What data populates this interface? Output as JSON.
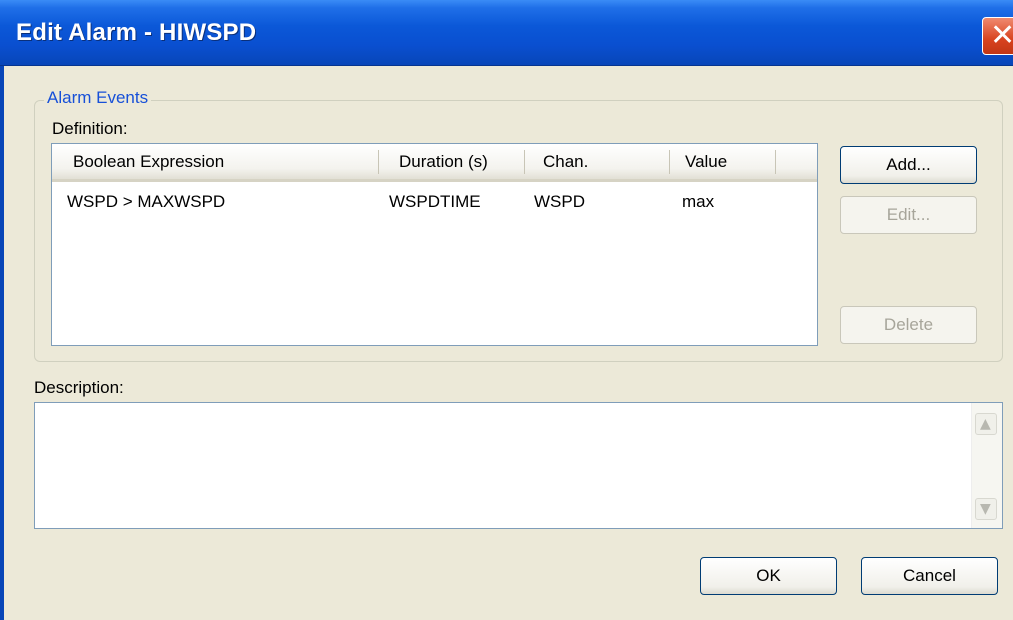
{
  "window": {
    "title": "Edit Alarm - HIWSPD"
  },
  "group": {
    "legend": "Alarm Events"
  },
  "definition": {
    "label": "Definition:",
    "columns": [
      "Boolean Expression",
      "Duration (s)",
      "Chan.",
      "Value"
    ],
    "rows": [
      [
        "WSPD > MAXWSPD",
        "WSPDTIME",
        "WSPD",
        "max"
      ]
    ]
  },
  "buttons": {
    "add": "Add...",
    "edit": "Edit...",
    "delete": "Delete",
    "ok": "OK",
    "cancel": "Cancel"
  },
  "description": {
    "label": "Description:",
    "value": ""
  },
  "icons": {
    "close": "close-icon",
    "scroll_up": "scroll-up-arrow-icon",
    "scroll_down": "scroll-down-arrow-icon"
  }
}
